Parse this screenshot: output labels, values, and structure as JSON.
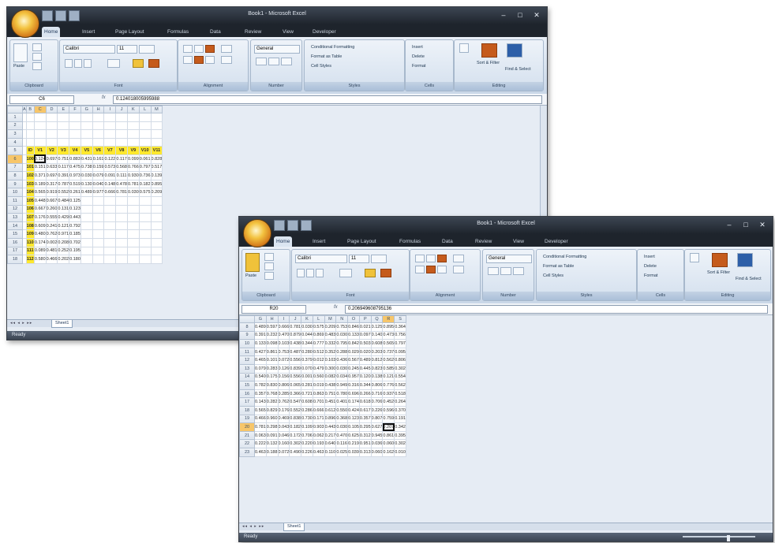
{
  "windows": [
    {
      "title": "Book1 - Microsoft Excel",
      "tabs": [
        "Home",
        "Insert",
        "Page Layout",
        "Formulas",
        "Data",
        "Review",
        "View",
        "Developer"
      ],
      "ribbon": {
        "paste_label": "Paste",
        "font_name": "Calibri",
        "font_size": "11",
        "number_format": "General",
        "styles": [
          "Conditional Formatting",
          "Format as Table",
          "Cell Styles"
        ],
        "cells": [
          "Insert",
          "Delete",
          "Format"
        ],
        "editing": [
          "Sort & Filter",
          "Find & Select"
        ],
        "group_labels": [
          "Clipboard",
          "Font",
          "Alignment",
          "Number",
          "Styles",
          "Cells",
          "Editing"
        ]
      },
      "name_box": "C6",
      "formula_value": "0.124018005995988",
      "sheet_tab": "Sheet1",
      "status": "Ready",
      "column_headers": [
        "A",
        "B",
        "C",
        "D",
        "E",
        "F",
        "G",
        "H",
        "I",
        "J",
        "K",
        "L",
        "M"
      ],
      "rows": [
        {
          "n": "1",
          "cells": [
            "",
            "",
            "",
            "",
            "",
            "",
            "",
            "",
            "",
            "",
            "",
            ""
          ]
        },
        {
          "n": "2",
          "cells": [
            "",
            "",
            "",
            "",
            "",
            "",
            "",
            "",
            "",
            "",
            "",
            ""
          ]
        },
        {
          "n": "3",
          "cells": [
            "",
            "",
            "",
            "",
            "",
            "",
            "",
            "",
            "",
            "",
            "",
            ""
          ]
        },
        {
          "n": "4",
          "cells": [
            "",
            "",
            "",
            "",
            "",
            "",
            "",
            "",
            "",
            "",
            "",
            ""
          ]
        },
        {
          "n": "5",
          "cells": [
            "",
            "ID",
            "V1",
            "V2",
            "V3",
            "V4",
            "V5",
            "V6",
            "V7",
            "V8",
            "V9",
            "V10",
            "V11"
          ]
        },
        {
          "n": "6",
          "cells": [
            "",
            "100",
            "0.124",
            "0.697",
            "0.751",
            "0.883",
            "0.431",
            "0.161",
            "0.122",
            "0.117",
            "0.099",
            "0.061",
            "0.828"
          ]
        },
        {
          "n": "7",
          "cells": [
            "",
            "101",
            "0.151",
            "0.633",
            "0.117",
            "0.475",
            "0.738",
            "0.159",
            "0.573",
            "0.568",
            "0.766",
            "0.797",
            "0.517"
          ]
        },
        {
          "n": "8",
          "cells": [
            "",
            "102",
            "0.371",
            "0.697",
            "0.391",
            "0.973",
            "0.030",
            "0.079",
            "0.091",
            "0.111",
            "0.930",
            "0.736",
            "0.139"
          ]
        },
        {
          "n": "9",
          "cells": [
            "",
            "103",
            "0.189",
            "0.317",
            "0.787",
            "0.519",
            "0.130",
            "0.040",
            "0.148",
            "0.478",
            "0.781",
            "0.182",
            "0.895"
          ]
        },
        {
          "n": "10",
          "cells": [
            "",
            "104",
            "0.565",
            "0.919",
            "0.552",
            "0.261",
            "0.489",
            "0.977",
            "0.666",
            "0.781",
            "0.030",
            "0.575",
            "0.209"
          ]
        },
        {
          "n": "11",
          "cells": [
            "",
            "105",
            "0.448",
            "0.667",
            "0.484",
            "0.125",
            "",
            "",
            "",
            "",
            "",
            "",
            ""
          ]
        },
        {
          "n": "12",
          "cells": [
            "",
            "106",
            "0.667",
            "0.260",
            "0.131",
            "0.123",
            "",
            "",
            "",
            "",
            "",
            "",
            ""
          ]
        },
        {
          "n": "13",
          "cells": [
            "",
            "107",
            "0.176",
            "0.555",
            "0.429",
            "0.443",
            "",
            "",
            "",
            "",
            "",
            "",
            ""
          ]
        },
        {
          "n": "14",
          "cells": [
            "",
            "108",
            "0.609",
            "0.241",
            "0.121",
            "0.792",
            "",
            "",
            "",
            "",
            "",
            "",
            ""
          ]
        },
        {
          "n": "15",
          "cells": [
            "",
            "109",
            "0.480",
            "0.762",
            "0.971",
            "0.185",
            "",
            "",
            "",
            "",
            "",
            "",
            ""
          ]
        },
        {
          "n": "16",
          "cells": [
            "",
            "110",
            "0.174",
            "0.002",
            "0.208",
            "0.702",
            "",
            "",
            "",
            "",
            "",
            "",
            ""
          ]
        },
        {
          "n": "17",
          "cells": [
            "",
            "111",
            "0.089",
            "0.481",
            "0.252",
            "0.195",
            "",
            "",
            "",
            "",
            "",
            "",
            ""
          ]
        },
        {
          "n": "18",
          "cells": [
            "",
            "112",
            "0.580",
            "0.466",
            "0.202",
            "0.180",
            "",
            "",
            "",
            "",
            "",
            "",
            ""
          ]
        }
      ]
    },
    {
      "title": "Book1 - Microsoft Excel",
      "tabs": [
        "Home",
        "Insert",
        "Page Layout",
        "Formulas",
        "Data",
        "Review",
        "View",
        "Developer"
      ],
      "ribbon": {
        "paste_label": "Paste",
        "font_name": "Calibri",
        "font_size": "11",
        "number_format": "General",
        "styles": [
          "Conditional Formatting",
          "Format as Table",
          "Cell Styles"
        ],
        "cells": [
          "Insert",
          "Delete",
          "Format"
        ],
        "editing": [
          "Sort & Filter",
          "Find & Select"
        ],
        "group_labels": [
          "Clipboard",
          "Font",
          "Alignment",
          "Number",
          "Styles",
          "Cells",
          "Editing"
        ]
      },
      "name_box": "R20",
      "formula_value": "0.206949608795136",
      "sheet_tab": "Sheet1",
      "status": "Ready",
      "column_headers": [
        "G",
        "H",
        "I",
        "J",
        "K",
        "L",
        "M",
        "N",
        "O",
        "P",
        "Q",
        "R",
        "S"
      ],
      "rows": [
        {
          "n": "8",
          "cells": [
            "0.489",
            "0.597",
            "0.666",
            "0.781",
            "0.030",
            "0.575",
            "0.209",
            "0.753",
            "0.846",
            "0.021",
            "0.125",
            "0.895",
            "0.364"
          ]
        },
        {
          "n": "9",
          "cells": [
            "0.391",
            "0.232",
            "0.470",
            "0.879",
            "0.044",
            "0.869",
            "0.483",
            "0.030",
            "0.133",
            "0.097",
            "0.140",
            "0.473",
            "0.756"
          ]
        },
        {
          "n": "10",
          "cells": [
            "0.133",
            "0.098",
            "0.103",
            "0.438",
            "0.344",
            "0.777",
            "0.332",
            "0.795",
            "0.842",
            "0.503",
            "0.608",
            "0.565",
            "0.797"
          ]
        },
        {
          "n": "11",
          "cells": [
            "0.427",
            "0.861",
            "0.753",
            "0.487",
            "0.280",
            "0.512",
            "0.352",
            "0.288",
            "0.029",
            "0.020",
            "0.203",
            "0.737",
            "0.095"
          ]
        },
        {
          "n": "12",
          "cells": [
            "0.465",
            "0.101",
            "0.072",
            "0.556",
            "0.379",
            "0.012",
            "0.103",
            "0.436",
            "0.567",
            "0.489",
            "0.812",
            "0.562",
            "0.806"
          ]
        },
        {
          "n": "13",
          "cells": [
            "0.079",
            "0.283",
            "0.126",
            "0.839",
            "0.070",
            "0.479",
            "0.300",
            "0.030",
            "0.245",
            "0.445",
            "0.823",
            "0.585",
            "0.302"
          ]
        },
        {
          "n": "14",
          "cells": [
            "0.540",
            "0.175",
            "0.156",
            "0.556",
            "0.001",
            "0.560",
            "0.082",
            "0.034",
            "0.957",
            "0.120",
            "0.138",
            "0.121",
            "0.554"
          ]
        },
        {
          "n": "15",
          "cells": [
            "0.782",
            "0.830",
            "0.806",
            "0.065",
            "0.281",
            "0.019",
            "0.438",
            "0.949",
            "0.316",
            "0.344",
            "0.806",
            "0.776",
            "0.562"
          ]
        },
        {
          "n": "16",
          "cells": [
            "0.357",
            "0.768",
            "0.285",
            "0.366",
            "0.721",
            "0.863",
            "0.751",
            "0.780",
            "0.696",
            "0.266",
            "0.716",
            "0.937",
            "0.518"
          ]
        },
        {
          "n": "17",
          "cells": [
            "0.143",
            "0.282",
            "0.762",
            "0.547",
            "0.608",
            "0.701",
            "0.451",
            "0.401",
            "0.174",
            "0.618",
            "0.706",
            "0.452",
            "0.264"
          ]
        },
        {
          "n": "18",
          "cells": [
            "0.565",
            "0.829",
            "0.176",
            "0.552",
            "0.286",
            "0.666",
            "0.612",
            "0.550",
            "0.424",
            "0.617",
            "0.226",
            "0.596",
            "0.370"
          ]
        },
        {
          "n": "19",
          "cells": [
            "0.466",
            "0.960",
            "0.469",
            "0.838",
            "0.730",
            "0.171",
            "0.896",
            "0.368",
            "0.123",
            "0.357",
            "0.807",
            "0.759",
            "0.191"
          ]
        },
        {
          "n": "20",
          "cells": [
            "0.781",
            "0.298",
            "0.043",
            "0.182",
            "0.109",
            "0.903",
            "0.443",
            "0.030",
            "0.105",
            "0.295",
            "0.627",
            "0.207",
            "0.342"
          ]
        },
        {
          "n": "21",
          "cells": [
            "0.063",
            "0.091",
            "0.046",
            "0.172",
            "0.706",
            "0.062",
            "0.217",
            "0.470",
            "0.625",
            "0.312",
            "0.945",
            "0.861",
            "0.395"
          ]
        },
        {
          "n": "22",
          "cells": [
            "0.222",
            "0.132",
            "0.160",
            "0.302",
            "0.220",
            "0.193",
            "0.640",
            "0.116",
            "0.219",
            "0.951",
            "0.036",
            "0.060",
            "0.302"
          ]
        },
        {
          "n": "23",
          "cells": [
            "0.463",
            "0.188",
            "0.072",
            "0.490",
            "0.226",
            "0.463",
            "0.110",
            "0.025",
            "0.039",
            "0.313",
            "0.060",
            "0.162",
            "0.010"
          ]
        }
      ]
    }
  ]
}
